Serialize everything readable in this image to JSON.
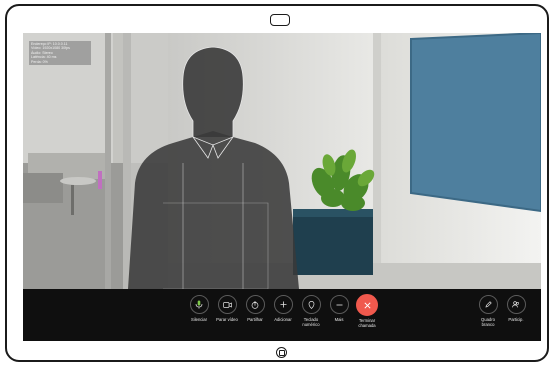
{
  "self_view": {
    "info_lines": "Endereço IP: 10.0.0.11\nVídeo: 1920x1080 30fps\nÁudio: Stereo\nLatência: 40 ms\nPerda: 0%"
  },
  "controls": {
    "mute": {
      "label": "Silenciar",
      "icon": "microphone-icon"
    },
    "stop_video": {
      "label": "Parar vídeo",
      "icon": "camera-icon"
    },
    "share": {
      "label": "Partilhar",
      "icon": "share-icon"
    },
    "add": {
      "label": "Adicionar",
      "icon": "plus-icon"
    },
    "keypad": {
      "label": "Teclado\nnumérico",
      "icon": "keypad-icon"
    },
    "more": {
      "label": "Mais",
      "icon": "ellipsis-icon"
    },
    "end_call": {
      "label": "Terminar\nchamada",
      "icon": "close-icon",
      "color": "#f0594d"
    },
    "whiteboard": {
      "label": "Quadro\nbranco",
      "icon": "pen-icon"
    },
    "participants": {
      "label": "Particip.",
      "icon": "people-icon"
    }
  },
  "colors": {
    "control_bar": "#0f0f0f",
    "end_call": "#f0594d",
    "wall_panel": "#4e7f9e"
  }
}
